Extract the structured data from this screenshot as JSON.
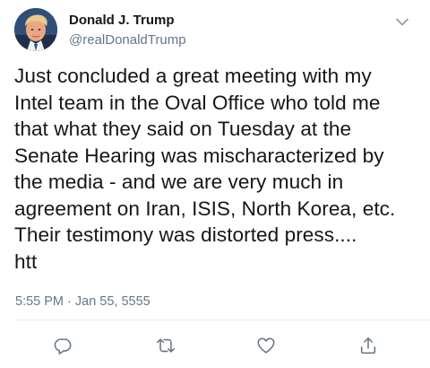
{
  "user": {
    "display_name": "Donald J. Trump",
    "handle": "@realDonaldTrump",
    "avatar_icon": "profile-photo"
  },
  "tweet": {
    "text": "Just concluded a great meeting with my\nIntel team in the Oval Office who told me\nthat what they said on Tuesday at the\nSenate Hearing was mischaracterized by\nthe media - and we are very much in\nagreement on Iran, ISIS, North Korea, etc.\nTheir testimony was distorted press....\nhtt",
    "timestamp": "5:55 PM · Jan 55, 5555"
  },
  "actions": [
    {
      "name": "reply",
      "icon": "reply-icon"
    },
    {
      "name": "retweet",
      "icon": "retweet-icon"
    },
    {
      "name": "like",
      "icon": "heart-icon"
    },
    {
      "name": "share",
      "icon": "share-icon"
    }
  ],
  "colors": {
    "text": "#14171a",
    "secondary": "#657786",
    "icon": "#657786",
    "divider": "#e6ecf0"
  }
}
